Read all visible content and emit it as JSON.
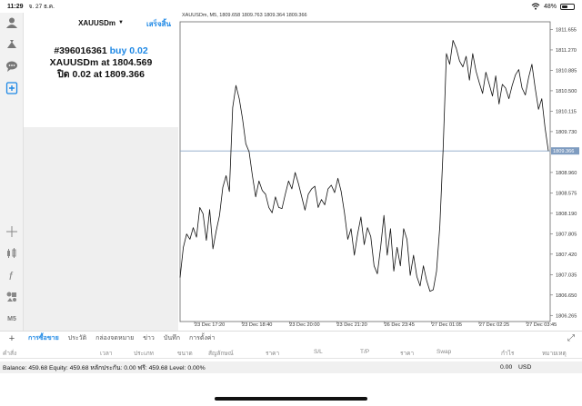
{
  "status": {
    "time": "11:29",
    "date": "จ. 27 ธ.ค.",
    "battery": "48%",
    "battery_level": 0.48
  },
  "order_panel": {
    "symbol": "XAUUSDm",
    "done_label": "เสร็จสิ้น",
    "ticket": "#396016361",
    "action": "buy 0.02",
    "line2_prefix": "XAUUSDm at",
    "open_price": "1804.569",
    "line3_prefix": "ปิด 0.02 at",
    "close_price": "1809.366"
  },
  "toolbar": {
    "timeframe_label": "M5"
  },
  "chart_data": {
    "type": "line",
    "header": "XAUUSDm, M5, 1809.658 1809.763 1809.364 1809.366",
    "x_ticks": [
      "23 Dec 17:20",
      "23 Dec 18:40",
      "23 Dec 20:00",
      "23 Dec 21:20",
      "26 Dec 23:45",
      "27 Dec 01:05",
      "27 Dec 02:25",
      "27 Dec 03:45"
    ],
    "y_ticks": [
      "1811.655",
      "1811.270",
      "1810.885",
      "1810.500",
      "1810.115",
      "1809.730",
      "1808.960",
      "1808.575",
      "1808.190",
      "1807.805",
      "1807.420",
      "1807.035",
      "1806.650",
      "1806.265"
    ],
    "ylim": [
      1806.15,
      1811.8
    ],
    "current_price": "1809.366",
    "values": [
      1806.98,
      1807.55,
      1807.8,
      1807.7,
      1807.92,
      1807.74,
      1808.3,
      1808.18,
      1807.68,
      1808.26,
      1807.52,
      1807.86,
      1808.15,
      1808.68,
      1808.9,
      1808.6,
      1810.18,
      1810.6,
      1810.35,
      1809.97,
      1809.5,
      1809.35,
      1808.9,
      1808.5,
      1808.8,
      1808.62,
      1808.55,
      1808.3,
      1808.2,
      1808.5,
      1808.3,
      1808.28,
      1808.55,
      1808.8,
      1808.65,
      1808.96,
      1808.75,
      1808.5,
      1808.25,
      1808.55,
      1808.65,
      1808.7,
      1808.3,
      1808.45,
      1808.35,
      1808.65,
      1808.72,
      1808.58,
      1808.85,
      1808.6,
      1808.2,
      1807.7,
      1807.9,
      1807.4,
      1807.8,
      1808.12,
      1807.6,
      1807.92,
      1807.75,
      1807.2,
      1807.05,
      1807.55,
      1808.15,
      1807.4,
      1807.9,
      1807.1,
      1807.55,
      1807.2,
      1807.9,
      1807.7,
      1807.02,
      1807.4,
      1807.0,
      1806.82,
      1807.2,
      1806.92,
      1806.72,
      1806.75,
      1807.1,
      1807.95,
      1809.4,
      1811.2,
      1811.0,
      1811.45,
      1811.3,
      1811.06,
      1810.95,
      1811.15,
      1810.7,
      1811.2,
      1810.87,
      1810.65,
      1810.45,
      1810.85,
      1810.63,
      1810.4,
      1810.78,
      1810.25,
      1810.62,
      1810.55,
      1810.35,
      1810.6,
      1810.8,
      1810.9,
      1810.55,
      1810.42,
      1810.75,
      1811.0,
      1810.55,
      1810.15,
      1810.35,
      1809.8,
      1809.366
    ]
  },
  "tabs": [
    {
      "label": "การซื้อขาย",
      "active": true
    },
    {
      "label": "ประวัติ"
    },
    {
      "label": "กล่องจดหมาย"
    },
    {
      "label": "ข่าว"
    },
    {
      "label": "บันทึก"
    },
    {
      "label": "การตั้งค่า"
    }
  ],
  "columns": [
    "คำสั่ง",
    "เวลา",
    "ประเภท",
    "ขนาด",
    "สัญลักษณ์",
    "ราคา",
    "S/L",
    "T/P",
    "ราคา",
    "Swap",
    "กำไร",
    "หมายเหตุ"
  ],
  "balance": {
    "text": "Balance: 459.68 Equity: 459.68 หลักประกัน: 0.00 ฟรี: 459.68 Level: 0.00%",
    "profit": "0.00",
    "currency": "USD"
  }
}
